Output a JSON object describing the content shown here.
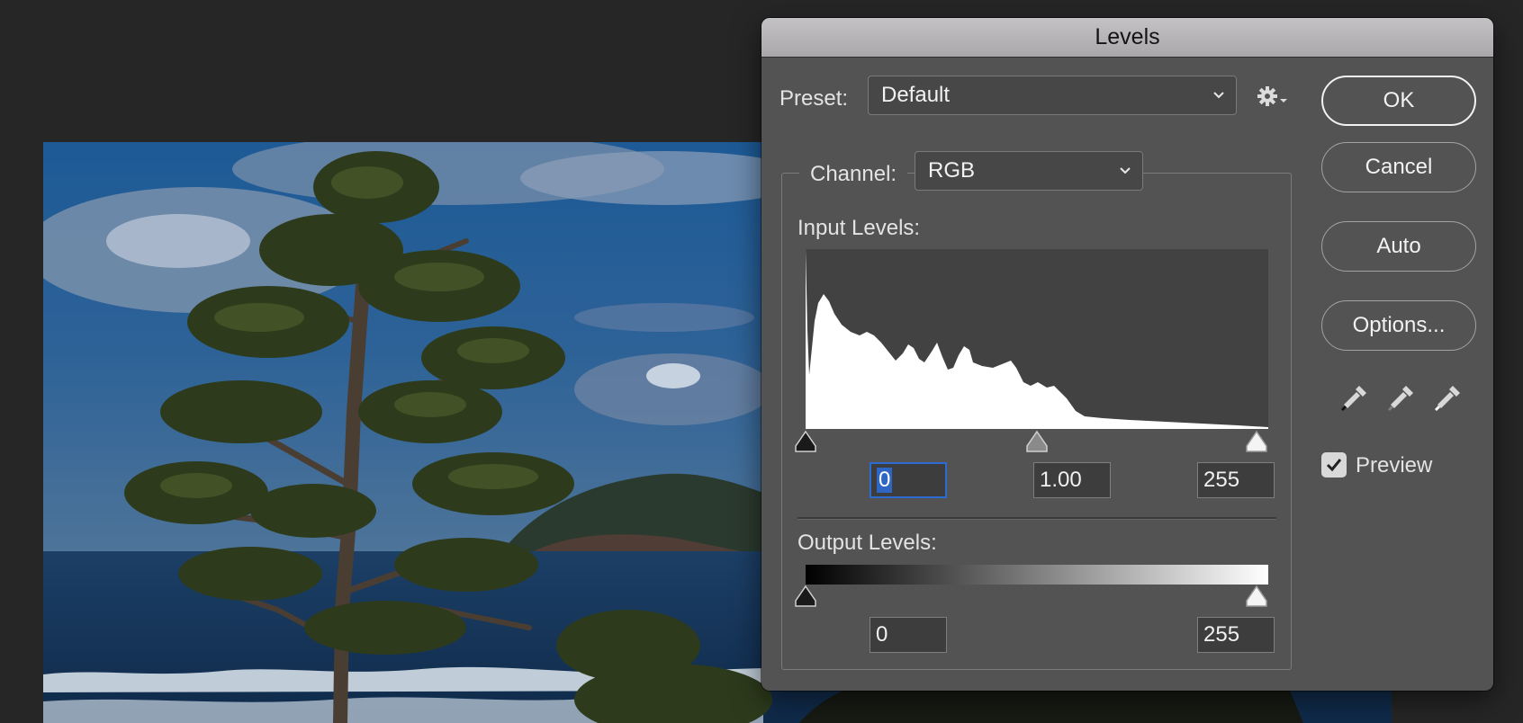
{
  "dialog": {
    "title": "Levels",
    "preset_label": "Preset:",
    "preset_value": "Default",
    "channel_label": "Channel:",
    "channel_value": "RGB",
    "input_levels_label": "Input Levels:",
    "output_levels_label": "Output Levels:",
    "input_black": "0",
    "input_gamma": "1.00",
    "input_white": "255",
    "output_black": "0",
    "output_white": "255",
    "buttons": {
      "ok": "OK",
      "cancel": "Cancel",
      "auto": "Auto",
      "options": "Options..."
    },
    "preview_label": "Preview",
    "preview_checked": true
  },
  "icons": {
    "settings": "gear-icon",
    "black_point": "eyedropper-black-icon",
    "gray_point": "eyedropper-gray-icon",
    "white_point": "eyedropper-white-icon"
  },
  "colors": {
    "dialog_bg": "#535353",
    "focus_ring": "#2b6bd2",
    "histogram_fill": "#ffffff"
  }
}
